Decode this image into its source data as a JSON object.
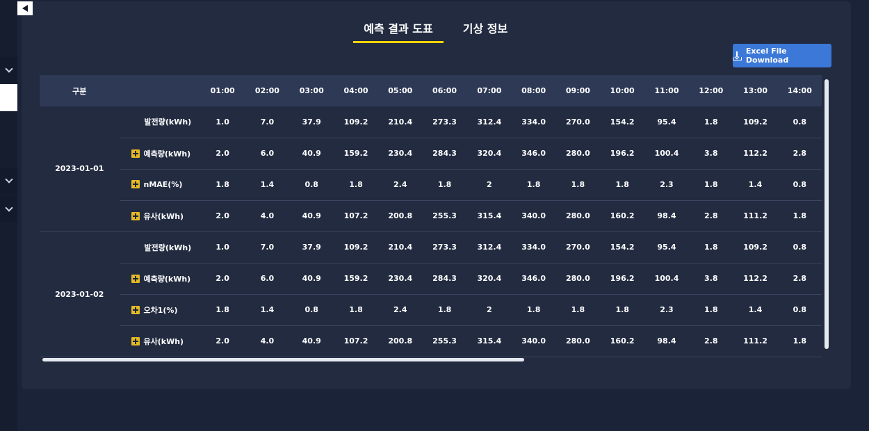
{
  "tabs": [
    {
      "label": "예측 결과 도표",
      "active": true
    },
    {
      "label": "기상 정보",
      "active": false
    }
  ],
  "download_button": {
    "label": "Excel File Download"
  },
  "table": {
    "header_label": "구분",
    "hours": [
      "01:00",
      "02:00",
      "03:00",
      "04:00",
      "05:00",
      "06:00",
      "07:00",
      "08:00",
      "09:00",
      "10:00",
      "11:00",
      "12:00",
      "13:00",
      "14:00"
    ],
    "groups": [
      {
        "date": "2023-01-01",
        "rows": [
          {
            "label": "발전량(kWh)",
            "expandable": false,
            "values": [
              "1.0",
              "7.0",
              "37.9",
              "109.2",
              "210.4",
              "273.3",
              "312.4",
              "334.0",
              "270.0",
              "154.2",
              "95.4",
              "1.8",
              "109.2",
              "0.8"
            ]
          },
          {
            "label": "예측량(kWh)",
            "expandable": true,
            "values": [
              "2.0",
              "6.0",
              "40.9",
              "159.2",
              "230.4",
              "284.3",
              "320.4",
              "346.0",
              "280.0",
              "196.2",
              "100.4",
              "3.8",
              "112.2",
              "2.8"
            ]
          },
          {
            "label": "nMAE(%)",
            "expandable": true,
            "values": [
              "1.8",
              "1.4",
              "0.8",
              "1.8",
              "2.4",
              "1.8",
              "2",
              "1.8",
              "1.8",
              "1.8",
              "2.3",
              "1.8",
              "1.4",
              "0.8"
            ]
          },
          {
            "label": "유사(kWh)",
            "expandable": true,
            "values": [
              "2.0",
              "4.0",
              "40.9",
              "107.2",
              "200.8",
              "255.3",
              "315.4",
              "340.0",
              "280.0",
              "160.2",
              "98.4",
              "2.8",
              "111.2",
              "1.8"
            ]
          }
        ]
      },
      {
        "date": "2023-01-02",
        "rows": [
          {
            "label": "발전량(kWh)",
            "expandable": false,
            "values": [
              "1.0",
              "7.0",
              "37.9",
              "109.2",
              "210.4",
              "273.3",
              "312.4",
              "334.0",
              "270.0",
              "154.2",
              "95.4",
              "1.8",
              "109.2",
              "0.8"
            ]
          },
          {
            "label": "예측량(kWh)",
            "expandable": true,
            "values": [
              "2.0",
              "6.0",
              "40.9",
              "159.2",
              "230.4",
              "284.3",
              "320.4",
              "346.0",
              "280.0",
              "196.2",
              "100.4",
              "3.8",
              "112.2",
              "2.8"
            ]
          },
          {
            "label": "오차1(%)",
            "expandable": true,
            "values": [
              "1.8",
              "1.4",
              "0.8",
              "1.8",
              "2.4",
              "1.8",
              "2",
              "1.8",
              "1.8",
              "1.8",
              "2.3",
              "1.8",
              "1.4",
              "0.8"
            ]
          },
          {
            "label": "유사(kWh)",
            "expandable": true,
            "values": [
              "2.0",
              "4.0",
              "40.9",
              "107.2",
              "200.8",
              "255.3",
              "315.4",
              "340.0",
              "280.0",
              "160.2",
              "98.4",
              "2.8",
              "111.2",
              "1.8"
            ]
          }
        ]
      }
    ]
  },
  "colors": {
    "background": "#1b2338",
    "card": "#222b40",
    "header_row": "#2d3955",
    "accent_tab_underline": "#ffd400",
    "button": "#3b78d8",
    "plus_icon": "#e4b923"
  }
}
